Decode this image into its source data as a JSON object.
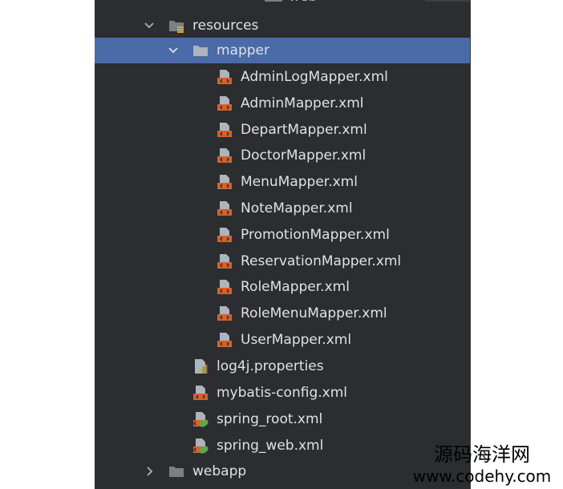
{
  "tree": {
    "top_partial_label": "web",
    "resources": {
      "label": "resources",
      "expanded": true
    },
    "mapper": {
      "label": "mapper",
      "expanded": true,
      "selected": true
    },
    "mapper_files": [
      "AdminLogMapper.xml",
      "AdminMapper.xml",
      "DepartMapper.xml",
      "DoctorMapper.xml",
      "MenuMapper.xml",
      "NoteMapper.xml",
      "PromotionMapper.xml",
      "ReservationMapper.xml",
      "RoleMapper.xml",
      "RoleMenuMapper.xml",
      "UserMapper.xml"
    ],
    "resource_files": [
      {
        "label": "log4j.properties",
        "icon": "properties-file-icon"
      },
      {
        "label": "mybatis-config.xml",
        "icon": "xml-file-icon"
      },
      {
        "label": "spring_root.xml",
        "icon": "spring-xml-file-icon"
      },
      {
        "label": "spring_web.xml",
        "icon": "spring-xml-file-icon"
      }
    ],
    "webapp": {
      "label": "webapp",
      "expanded": false
    }
  },
  "watermark": {
    "line1": "源码海洋网",
    "line2": "www.codehy.com"
  },
  "colors": {
    "panel_bg": "#2b2d30",
    "selection_bg": "#4a6aa8",
    "text": "#dfe1e5",
    "xml_accent": "#d4622b",
    "spring_green": "#5fa84a"
  }
}
